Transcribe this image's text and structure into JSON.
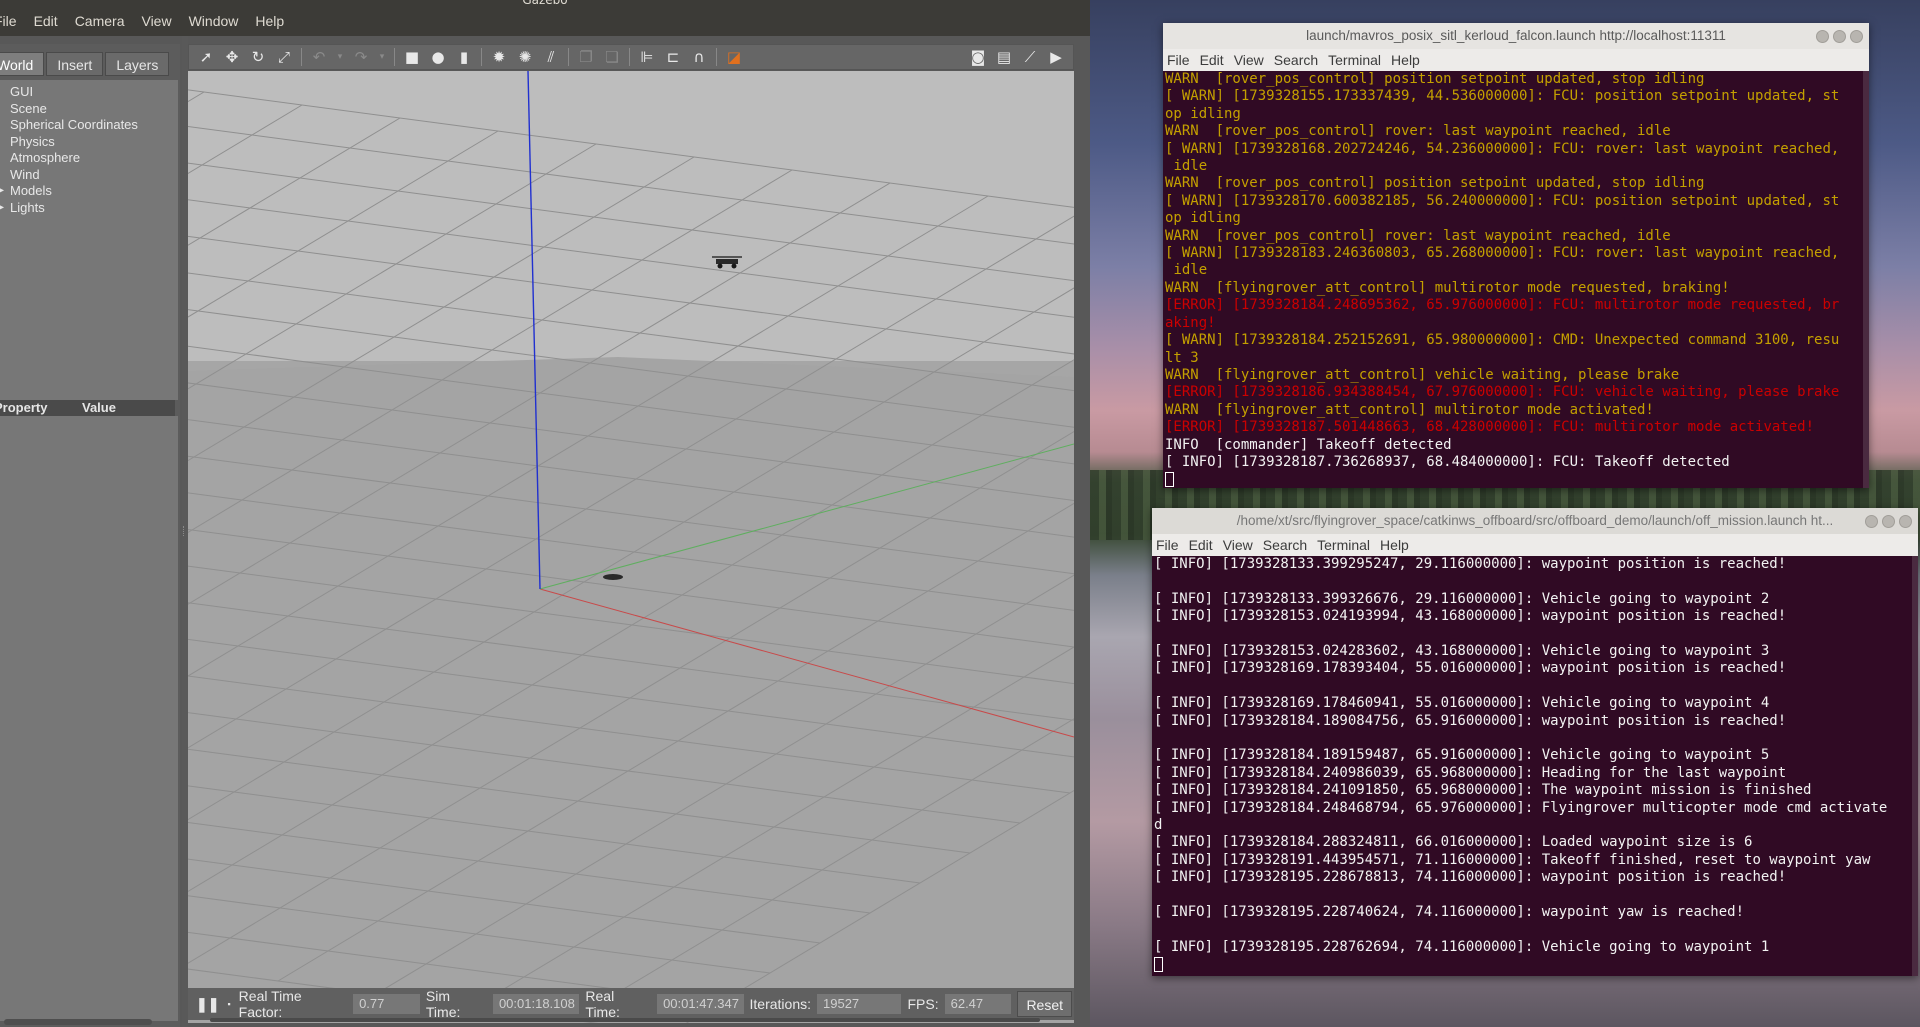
{
  "gazebo": {
    "title": "Gazebo",
    "menu": [
      "File",
      "Edit",
      "Camera",
      "View",
      "Window",
      "Help"
    ],
    "tabs": [
      "World",
      "Insert",
      "Layers"
    ],
    "tree": [
      {
        "label": "GUI",
        "arrow": false
      },
      {
        "label": "Scene",
        "arrow": false
      },
      {
        "label": "Spherical Coordinates",
        "arrow": false
      },
      {
        "label": "Physics",
        "arrow": false
      },
      {
        "label": "Atmosphere",
        "arrow": false
      },
      {
        "label": "Wind",
        "arrow": false
      },
      {
        "label": "Models",
        "arrow": true
      },
      {
        "label": "Lights",
        "arrow": true
      }
    ],
    "property_header": {
      "property": "Property",
      "value": "Value"
    },
    "status": {
      "rtf_label": "Real Time Factor:",
      "rtf": "0.77",
      "sim_label": "Sim Time:",
      "sim": "00:01:18.108",
      "real_label": "Real Time:",
      "real": "00:01:47.347",
      "iter_label": "Iterations:",
      "iter": "19527",
      "fps_label": "FPS:",
      "fps": "62.47",
      "reset": "Reset"
    },
    "colors": {
      "axis_x": "#c84a4a",
      "axis_y": "#5fae5f",
      "axis_z": "#2030d0",
      "grid": "#8f8f8f"
    }
  },
  "terminal1": {
    "title": "launch/mavros_posix_sitl_kerloud_falcon.launch http://localhost:11311",
    "menu": [
      "File",
      "Edit",
      "View",
      "Search",
      "Terminal",
      "Help"
    ],
    "lines": [
      {
        "t": "warn",
        "text": "WARN  [rover_pos_control] position setpoint updated, stop idling"
      },
      {
        "t": "warn",
        "text": "[ WARN] [1739328155.173337439, 44.536000000]: FCU: position setpoint updated, st"
      },
      {
        "t": "warn",
        "text": "op idling"
      },
      {
        "t": "warn",
        "text": "WARN  [rover_pos_control] rover: last waypoint reached, idle"
      },
      {
        "t": "warn",
        "text": "[ WARN] [1739328168.202724246, 54.236000000]: FCU: rover: last waypoint reached,"
      },
      {
        "t": "warn",
        "text": " idle"
      },
      {
        "t": "warn",
        "text": "WARN  [rover_pos_control] position setpoint updated, stop idling"
      },
      {
        "t": "warn",
        "text": "[ WARN] [1739328170.600382185, 56.240000000]: FCU: position setpoint updated, st"
      },
      {
        "t": "warn",
        "text": "op idling"
      },
      {
        "t": "warn",
        "text": "WARN  [rover_pos_control] rover: last waypoint reached, idle"
      },
      {
        "t": "warn",
        "text": "[ WARN] [1739328183.246360803, 65.268000000]: FCU: rover: last waypoint reached,"
      },
      {
        "t": "warn",
        "text": " idle"
      },
      {
        "t": "warn",
        "text": "WARN  [flyingrover_att_control] multirotor mode requested, braking!"
      },
      {
        "t": "err",
        "text": "[ERROR] [1739328184.248695362, 65.976000000]: FCU: multirotor mode requested, br"
      },
      {
        "t": "err",
        "text": "aking!"
      },
      {
        "t": "warn",
        "text": "[ WARN] [1739328184.252152691, 65.980000000]: CMD: Unexpected command 3100, resu"
      },
      {
        "t": "warn",
        "text": "lt 3"
      },
      {
        "t": "warn",
        "text": "WARN  [flyingrover_att_control] vehicle waiting, please brake"
      },
      {
        "t": "err",
        "text": "[ERROR] [1739328186.934388454, 67.976000000]: FCU: vehicle waiting, please brake"
      },
      {
        "t": "warn",
        "text": "WARN  [flyingrover_att_control] multirotor mode activated!"
      },
      {
        "t": "err",
        "text": "[ERROR] [1739328187.501448663, 68.428000000]: FCU: multirotor mode activated!"
      },
      {
        "t": "info",
        "text": "INFO  [commander] Takeoff detected"
      },
      {
        "t": "info",
        "text": "[ INFO] [1739328187.736268937, 68.484000000]: FCU: Takeoff detected"
      }
    ]
  },
  "terminal2": {
    "title": "/home/xt/src/flyingrover_space/catkinws_offboard/src/offboard_demo/launch/off_mission.launch ht...",
    "menu": [
      "File",
      "Edit",
      "View",
      "Search",
      "Terminal",
      "Help"
    ],
    "lines": [
      "[ INFO] [1739328133.399295247, 29.116000000]: waypoint position is reached!",
      "",
      "[ INFO] [1739328133.399326676, 29.116000000]: Vehicle going to waypoint 2",
      "[ INFO] [1739328153.024193994, 43.168000000]: waypoint position is reached!",
      "",
      "[ INFO] [1739328153.024283602, 43.168000000]: Vehicle going to waypoint 3",
      "[ INFO] [1739328169.178393404, 55.016000000]: waypoint position is reached!",
      "",
      "[ INFO] [1739328169.178460941, 55.016000000]: Vehicle going to waypoint 4",
      "[ INFO] [1739328184.189084756, 65.916000000]: waypoint position is reached!",
      "",
      "[ INFO] [1739328184.189159487, 65.916000000]: Vehicle going to waypoint 5",
      "[ INFO] [1739328184.240986039, 65.968000000]: Heading for the last waypoint",
      "[ INFO] [1739328184.241091850, 65.968000000]: The waypoint mission is finished",
      "[ INFO] [1739328184.248468794, 65.976000000]: Flyingrover multicopter mode cmd activate",
      "d",
      "[ INFO] [1739328184.288324811, 66.016000000]: Loaded waypoint size is 6",
      "[ INFO] [1739328191.443954571, 71.116000000]: Takeoff finished, reset to waypoint yaw",
      "[ INFO] [1739328195.228678813, 74.116000000]: waypoint position is reached!",
      "",
      "[ INFO] [1739328195.228740624, 74.116000000]: waypoint yaw is reached!",
      "",
      "[ INFO] [1739328195.228762694, 74.116000000]: Vehicle going to waypoint 1"
    ]
  },
  "icons": [
    "arrow-select-icon",
    "translate-icon",
    "rotate-icon",
    "scale-icon",
    "undo-icon",
    "redo-icon",
    "box-icon",
    "sphere-icon",
    "cylinder-icon",
    "point-light-icon",
    "spot-light-icon",
    "directional-light-icon",
    "copy-icon",
    "paste-icon",
    "align-icon",
    "snap-icon",
    "magnet-icon",
    "view-angle-icon",
    "screenshot-icon",
    "log-icon",
    "plot-icon",
    "video-icon"
  ]
}
